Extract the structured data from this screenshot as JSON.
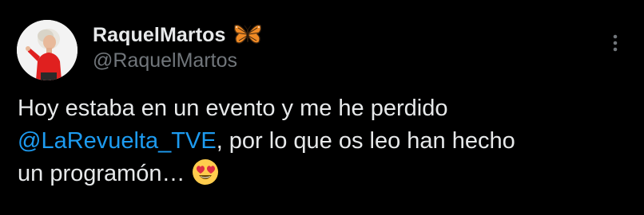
{
  "tweet": {
    "author": {
      "display_name": "RaquelMartos",
      "name_badge_icon": "butterfly-emoji",
      "handle": "@RaquelMartos",
      "avatar_icon": "profile-photo"
    },
    "more_menu_icon": "more-vertical-icon",
    "text": {
      "line1": "Hoy estaba en un evento y me he perdido",
      "mention": "@LaRevuelta_TVE",
      "line2_rest": ", por lo que os leo han hecho",
      "line3": "un programón…",
      "emoji_icon": "heart-eyes-emoji"
    }
  },
  "colors": {
    "background": "#000000",
    "text_primary": "#e7e9ea",
    "text_secondary": "#71767b",
    "accent_link": "#1d9bf0"
  }
}
